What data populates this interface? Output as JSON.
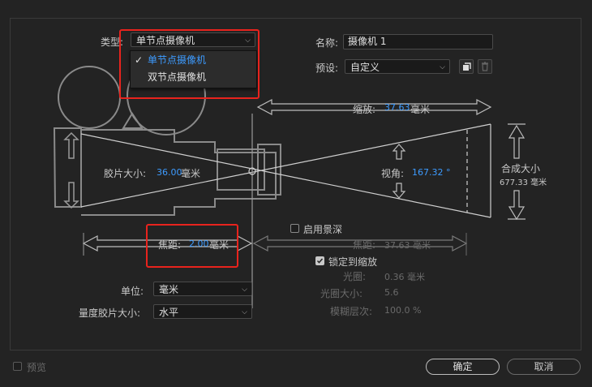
{
  "dialog": {
    "type_label": "类型:",
    "type_value": "单节点摄像机",
    "type_menu": [
      {
        "label": "单节点摄像机",
        "checked": true
      },
      {
        "label": "双节点摄像机",
        "checked": false
      }
    ],
    "name_label": "名称:",
    "name_value": "摄像机 1",
    "preset_label": "预设:",
    "preset_value": "自定义",
    "diagram": {
      "zoom_label": "缩放:",
      "zoom_value": "37.63",
      "zoom_unit": "毫米",
      "film_size_label": "胶片大小:",
      "film_size_value": "36.00",
      "film_size_unit": "毫米",
      "angle_label": "视角:",
      "angle_value": "167.32 °",
      "comp_size_label": "合成大小",
      "comp_size_value": "677.33 毫米",
      "focal_label": "焦距:",
      "focal_value": "2.00",
      "focal_unit": "毫米",
      "dof_focus_label": "焦距:",
      "dof_focus_value": "37.63 毫米"
    },
    "dof": {
      "enable_label": "启用景深",
      "enable_checked": false,
      "lock_label": "锁定到缩放",
      "lock_checked": true,
      "aperture_label": "光圈:",
      "aperture_value": "0.36 毫米",
      "fstop_label": "光圈大小:",
      "fstop_value": "5.6",
      "blur_label": "模糊层次:",
      "blur_value": "100.0 %"
    },
    "units_label": "单位:",
    "units_value": "毫米",
    "measure_label": "量度胶片大小:",
    "measure_value": "水平",
    "preview_label": "预览",
    "preview_checked": false,
    "ok_label": "确定",
    "cancel_label": "取消"
  }
}
